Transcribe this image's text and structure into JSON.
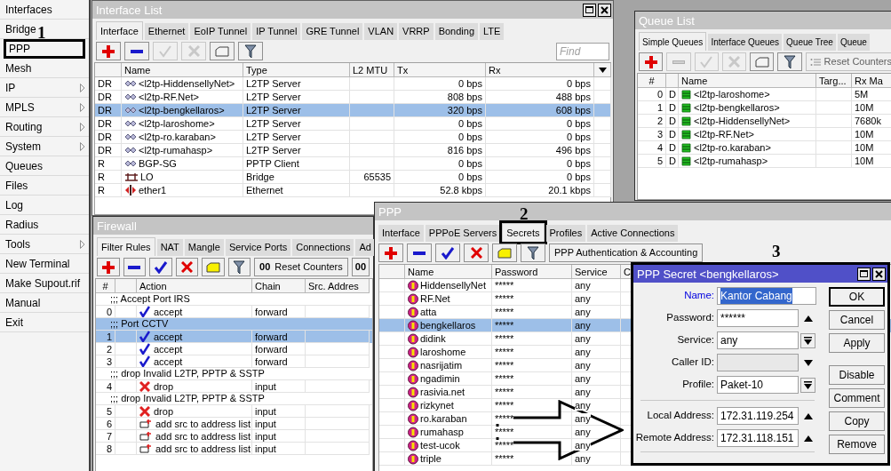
{
  "sidebar": {
    "items": [
      {
        "label": "Interfaces",
        "submenu": false,
        "boxed": false
      },
      {
        "label": "Bridge",
        "submenu": false,
        "boxed": false
      },
      {
        "label": "PPP",
        "submenu": false,
        "boxed": true
      },
      {
        "label": "Mesh",
        "submenu": false,
        "boxed": false
      },
      {
        "label": "IP",
        "submenu": true,
        "boxed": false
      },
      {
        "label": "MPLS",
        "submenu": true,
        "boxed": false
      },
      {
        "label": "Routing",
        "submenu": true,
        "boxed": false
      },
      {
        "label": "System",
        "submenu": true,
        "boxed": false
      },
      {
        "label": "Queues",
        "submenu": false,
        "boxed": false
      },
      {
        "label": "Files",
        "submenu": false,
        "boxed": false
      },
      {
        "label": "Log",
        "submenu": false,
        "boxed": false
      },
      {
        "label": "Radius",
        "submenu": false,
        "boxed": false
      },
      {
        "label": "Tools",
        "submenu": true,
        "boxed": false
      },
      {
        "label": "New Terminal",
        "submenu": false,
        "boxed": false
      },
      {
        "label": "Make Supout.rif",
        "submenu": false,
        "boxed": false
      },
      {
        "label": "Manual",
        "submenu": false,
        "boxed": false
      },
      {
        "label": "Exit",
        "submenu": false,
        "boxed": false
      }
    ]
  },
  "annotations": [
    "1",
    "2",
    "3"
  ],
  "interface_list": {
    "title": "Interface List",
    "actions_enabled": false,
    "tabs": [
      {
        "label": "Interface",
        "selected": true
      },
      {
        "label": "Ethernet",
        "selected": false
      },
      {
        "label": "EoIP Tunnel",
        "selected": false
      },
      {
        "label": "IP Tunnel",
        "selected": false
      },
      {
        "label": "GRE Tunnel",
        "selected": false
      },
      {
        "label": "VLAN",
        "selected": false
      },
      {
        "label": "VRRP",
        "selected": false
      },
      {
        "label": "Bonding",
        "selected": false
      },
      {
        "label": "LTE",
        "selected": false
      }
    ],
    "find_placeholder": "Find",
    "columns": [
      "Name",
      "Type",
      "L2 MTU",
      "Tx",
      "Rx"
    ],
    "rows": [
      {
        "flags": "DR",
        "kind": "tunnel",
        "name": "<l2tp-HiddensellyNet>",
        "type": "L2TP Server",
        "tx": "0 bps",
        "rx": "0 bps",
        "selected": false
      },
      {
        "flags": "DR",
        "kind": "tunnel",
        "name": "<l2tp-RF.Net>",
        "type": "L2TP Server",
        "tx": "808 bps",
        "rx": "488 bps",
        "selected": false
      },
      {
        "flags": "DR",
        "kind": "tunnel",
        "name": "<l2tp-bengkellaros>",
        "type": "L2TP Server",
        "tx": "320 bps",
        "rx": "608 bps",
        "selected": true
      },
      {
        "flags": "DR",
        "kind": "tunnel",
        "name": "<l2tp-laroshome>",
        "type": "L2TP Server",
        "tx": "0 bps",
        "rx": "0 bps",
        "selected": false
      },
      {
        "flags": "DR",
        "kind": "tunnel",
        "name": "<l2tp-ro.karaban>",
        "type": "L2TP Server",
        "tx": "0 bps",
        "rx": "0 bps",
        "selected": false
      },
      {
        "flags": "DR",
        "kind": "tunnel",
        "name": "<l2tp-rumahasp>",
        "type": "L2TP Server",
        "tx": "816 bps",
        "rx": "496 bps",
        "selected": false
      },
      {
        "flags": "R",
        "kind": "tunnel",
        "name": "BGP-SG",
        "type": "PPTP Client",
        "tx": "0 bps",
        "rx": "0 bps",
        "selected": false
      },
      {
        "flags": "R",
        "kind": "bridge",
        "name": "LO",
        "type": "Bridge",
        "l2_mtu": "65535",
        "tx": "0 bps",
        "rx": "0 bps",
        "selected": false
      },
      {
        "flags": "R",
        "kind": "ethernet",
        "name": "ether1",
        "type": "Ethernet",
        "tx": "52.8 kbps",
        "rx": "20.1 kbps",
        "selected": false
      }
    ]
  },
  "queue_list": {
    "title": "Queue List",
    "actions_enabled": false,
    "tabs": [
      {
        "label": "Simple Queues",
        "selected": true
      },
      {
        "label": "Interface Queues",
        "selected": false
      },
      {
        "label": "Queue Tree",
        "selected": false
      },
      {
        "label": "Queue",
        "selected": false
      }
    ],
    "reset_button": "Reset Counters",
    "columns": [
      "#",
      "Name",
      "Targ...",
      "Rx Ma"
    ],
    "rows": [
      {
        "num": "0",
        "flag": "D",
        "name": "<l2tp-laroshome>",
        "rx_max": "5M"
      },
      {
        "num": "1",
        "flag": "D",
        "name": "<l2tp-bengkellaros>",
        "rx_max": "10M"
      },
      {
        "num": "2",
        "flag": "D",
        "name": "<l2tp-HiddensellyNet>",
        "rx_max": "7680k"
      },
      {
        "num": "3",
        "flag": "D",
        "name": "<l2tp-RF.Net>",
        "rx_max": "10M"
      },
      {
        "num": "4",
        "flag": "D",
        "name": "<l2tp-ro.karaban>",
        "rx_max": "10M"
      },
      {
        "num": "5",
        "flag": "D",
        "name": "<l2tp-rumahasp>",
        "rx_max": "10M"
      }
    ]
  },
  "firewall": {
    "title": "Firewall",
    "actions_enabled": true,
    "tabs": [
      {
        "label": "Filter Rules",
        "selected": true
      },
      {
        "label": "NAT",
        "selected": false
      },
      {
        "label": "Mangle",
        "selected": false
      },
      {
        "label": "Service Ports",
        "selected": false
      },
      {
        "label": "Connections",
        "selected": false
      },
      {
        "label": "Ad",
        "selected": false
      }
    ],
    "counter_glyph": "00",
    "reset_button": "Reset Counters",
    "second_counter_glyph": "00",
    "columns": [
      "#",
      "Action",
      "Chain",
      "Src. Addres"
    ],
    "rows": [
      {
        "kind": "comment",
        "text": ";;; Accept Port IRS",
        "selected": false
      },
      {
        "kind": "accept",
        "num": "0",
        "action": "accept",
        "chain": "forward",
        "selected": false
      },
      {
        "kind": "comment",
        "text": ";;; Port CCTV",
        "selected": true
      },
      {
        "kind": "accept",
        "num": "1",
        "action": "accept",
        "chain": "forward",
        "selected": true
      },
      {
        "kind": "accept",
        "num": "2",
        "action": "accept",
        "chain": "forward",
        "selected": false
      },
      {
        "kind": "accept",
        "num": "3",
        "action": "accept",
        "chain": "forward",
        "selected": false
      },
      {
        "kind": "comment",
        "text": ";;; drop Invalid L2TP, PPTP & SSTP",
        "selected": false
      },
      {
        "kind": "drop",
        "num": "4",
        "action": "drop",
        "chain": "input",
        "selected": false
      },
      {
        "kind": "comment",
        "text": ";;; drop Invalid L2TP, PPTP & SSTP",
        "selected": false
      },
      {
        "kind": "drop",
        "num": "5",
        "action": "drop",
        "chain": "input",
        "selected": false
      },
      {
        "kind": "add",
        "num": "6",
        "action": "add src to address list",
        "chain": "input",
        "selected": false
      },
      {
        "kind": "add",
        "num": "7",
        "action": "add src to address list",
        "chain": "input",
        "selected": false
      },
      {
        "kind": "add",
        "num": "8",
        "action": "add src to address list",
        "chain": "input",
        "selected": false
      }
    ]
  },
  "ppp": {
    "title": "PPP",
    "actions_enabled": true,
    "tabs": [
      {
        "label": "Interface",
        "selected": false,
        "boxed": false
      },
      {
        "label": "PPPoE Servers",
        "selected": false,
        "boxed": false
      },
      {
        "label": "Secrets",
        "selected": true,
        "boxed": true
      },
      {
        "label": "Profiles",
        "selected": false,
        "boxed": false
      },
      {
        "label": "Active Connections",
        "selected": false,
        "boxed": false
      }
    ],
    "auth_button": "PPP Authentication & Accounting",
    "columns": [
      "Name",
      "Password",
      "Service",
      "C"
    ],
    "rows": [
      {
        "name": "HiddensellyNet",
        "password": "*****",
        "service": "any",
        "selected": false
      },
      {
        "name": "RF.Net",
        "password": "*****",
        "service": "any",
        "selected": false
      },
      {
        "name": "atta",
        "password": "*****",
        "service": "any",
        "selected": false
      },
      {
        "name": "bengkellaros",
        "password": "*****",
        "service": "any",
        "selected": true
      },
      {
        "name": "didink",
        "password": "*****",
        "service": "any",
        "selected": false
      },
      {
        "name": "laroshome",
        "password": "*****",
        "service": "any",
        "selected": false
      },
      {
        "name": "nasrijatim",
        "password": "*****",
        "service": "any",
        "selected": false
      },
      {
        "name": "ngadimin",
        "password": "*****",
        "service": "any",
        "selected": false
      },
      {
        "name": "rasivia.net",
        "password": "*****",
        "service": "any",
        "selected": false
      },
      {
        "name": "rizkynet",
        "password": "*****",
        "service": "any",
        "selected": false
      },
      {
        "name": "ro.karaban",
        "password": "*****",
        "service": "any",
        "selected": false
      },
      {
        "name": "rumahasp",
        "password": "*****",
        "service": "any",
        "selected": false
      },
      {
        "name": "test-ucok",
        "password": "*****",
        "service": "any",
        "selected": false
      },
      {
        "name": "triple",
        "password": "*****",
        "service": "any",
        "selected": false
      }
    ]
  },
  "secret_dialog": {
    "title": "PPP Secret <bengkellaros>",
    "fields": [
      {
        "label": "Name:",
        "value": "Kantor Cabang",
        "kind": "text",
        "focused": true
      },
      {
        "label": "Password:",
        "value": "******",
        "kind": "up",
        "focused": false
      },
      {
        "label": "Service:",
        "value": "any",
        "kind": "select",
        "focused": false
      },
      {
        "label": "Caller ID:",
        "kind": "down",
        "focused": false
      },
      {
        "label": "Profile:",
        "value": "Paket-10",
        "kind": "select",
        "focused": false
      }
    ],
    "address_fields": [
      {
        "label": "Local Address:",
        "value": "172.31.119.254",
        "kind": "up",
        "focused": false
      },
      {
        "label": "Remote Address:",
        "value": "172.31.118.151",
        "kind": "up",
        "focused": false
      }
    ],
    "buttons": [
      {
        "label": "OK",
        "default": true
      },
      {
        "label": "Cancel",
        "default": false
      },
      {
        "label": "Apply",
        "default": false
      }
    ],
    "item_buttons": [
      {
        "label": "Disable",
        "default": false
      },
      {
        "label": "Comment",
        "default": false
      },
      {
        "label": "Copy",
        "default": false
      },
      {
        "label": "Remove",
        "default": false
      }
    ]
  }
}
